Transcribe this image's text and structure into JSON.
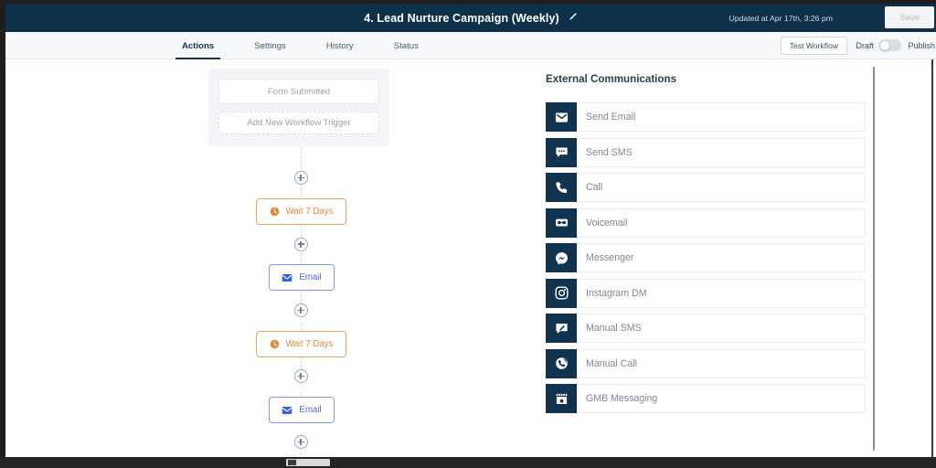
{
  "header": {
    "title": "4. Lead Nurture Campaign (Weekly)",
    "edit_icon": "pencil-icon",
    "updated_text": "Updated at Apr 17th, 3:26 pm",
    "save_label": "Save",
    "background_color": "#0e3048"
  },
  "tabbar": {
    "tabs": [
      {
        "label": "Actions",
        "active": true
      },
      {
        "label": "Settings",
        "active": false
      },
      {
        "label": "History",
        "active": false
      },
      {
        "label": "Status",
        "active": false
      }
    ],
    "test_workflow_label": "Test Workflow",
    "draft_label": "Draft",
    "publish_label": "Publish",
    "toggle_state": "off"
  },
  "canvas": {
    "trigger": {
      "existing_label": "Form Submitted",
      "add_label": "Add New Workflow Trigger"
    },
    "nodes": [
      {
        "label": "Wait 7 Days",
        "type": "wait",
        "icon": "clock-icon",
        "color": "#e08a3c"
      },
      {
        "label": "Email",
        "type": "email",
        "icon": "envelope-icon",
        "color": "#4a68d6"
      },
      {
        "label": "Wait 7 Days",
        "type": "wait",
        "icon": "clock-icon",
        "color": "#e08a3c"
      },
      {
        "label": "Email",
        "type": "email",
        "icon": "envelope-icon",
        "color": "#4a68d6"
      }
    ],
    "add_step_icon": "plus-circle-icon"
  },
  "panel": {
    "title": "External Communications",
    "items": [
      {
        "label": "Send Email",
        "icon": "envelope-icon"
      },
      {
        "label": "Send SMS",
        "icon": "chat-bubble-icon"
      },
      {
        "label": "Call",
        "icon": "phone-icon"
      },
      {
        "label": "Voicemail",
        "icon": "voicemail-cassette-icon"
      },
      {
        "label": "Messenger",
        "icon": "messenger-icon"
      },
      {
        "label": "Instagram DM",
        "icon": "instagram-icon"
      },
      {
        "label": "Manual SMS",
        "icon": "manual-sms-icon"
      },
      {
        "label": "Manual Call",
        "icon": "manual-call-icon"
      },
      {
        "label": "GMB Messaging",
        "icon": "storefront-icon"
      }
    ],
    "icon_tile_color": "#10344f"
  }
}
